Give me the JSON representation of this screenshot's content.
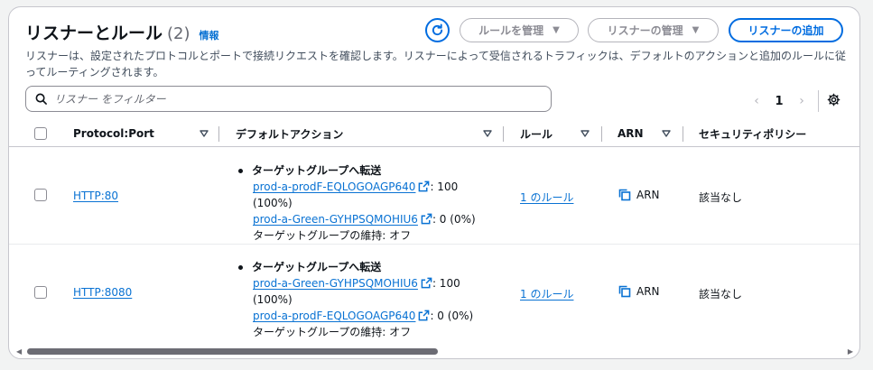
{
  "header": {
    "title": "リスナーとルール",
    "count": "(2)",
    "info_link": "情報",
    "description": "リスナーは、設定されたプロトコルとポートで接続リクエストを確認します。リスナーによって受信されるトラフィックは、デフォルトのアクションと追加のルールに従ってルーティングされます。"
  },
  "toolbar": {
    "manage_rules_label": "ルールを管理",
    "manage_listener_label": "リスナーの管理",
    "add_listener_label": "リスナーの追加"
  },
  "search": {
    "placeholder": "リスナー をフィルター",
    "value": ""
  },
  "pagination": {
    "current_page": "1"
  },
  "table": {
    "columns": [
      "Protocol:Port",
      "デフォルトアクション",
      "ルール",
      "ARN",
      "セキュリティポリシー"
    ],
    "rows": [
      {
        "protocol_port": "HTTP:80",
        "action_head": "ターゲットグループへ転送",
        "tg1_name": "prod-a-prodF-EQLOGOAGP640",
        "tg1_weight_a": ": 100",
        "tg1_weight_b": "(100%)",
        "tg2_name": "prod-a-Green-GYHPSQMOHIU6",
        "tg2_weight": ": 0 (0%)",
        "stickiness": "ターゲットグループの維持: オフ",
        "rules": "1 のルール",
        "arn": "ARN",
        "security_policy": "該当なし"
      },
      {
        "protocol_port": "HTTP:8080",
        "action_head": "ターゲットグループへ転送",
        "tg1_name": "prod-a-Green-GYHPSQMOHIU6",
        "tg1_weight_a": ": 100",
        "tg1_weight_b": "(100%)",
        "tg2_name": "prod-a-prodF-EQLOGOAGP640",
        "tg2_weight": ": 0 (0%)",
        "stickiness": "ターゲットグループの維持: オフ",
        "rules": "1 のルール",
        "arn": "ARN",
        "security_policy": "該当なし"
      }
    ]
  },
  "icons": {
    "refresh": "refresh-icon",
    "dropdown": "caret-down-icon",
    "search": "search-icon",
    "prev": "chevron-left-icon",
    "next": "chevron-right-icon",
    "settings": "gear-icon",
    "external": "external-link-icon",
    "copy": "copy-icon"
  },
  "colors": {
    "accent": "#0972d3",
    "primary_border": "#006ce0",
    "text": "#0f141a",
    "muted": "#656871"
  }
}
